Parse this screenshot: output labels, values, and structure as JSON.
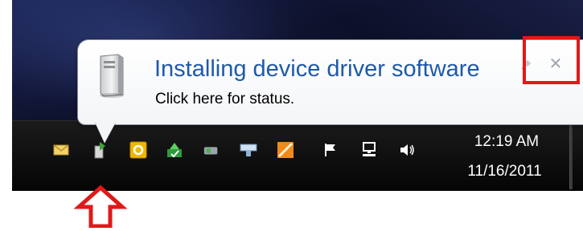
{
  "notification": {
    "title": "Installing device driver software",
    "body": "Click here for status."
  },
  "clock": {
    "time": "12:19 AM",
    "date": "11/16/2011"
  },
  "tray_icons": [
    "mail-icon",
    "device-driver-icon",
    "outlook-icon",
    "sync-icon",
    "vpn-icon",
    "keyboard-icon",
    "orange-app-icon",
    "action-center-flag-icon",
    "network-icon",
    "volume-icon"
  ],
  "colors": {
    "title_blue": "#1e5aa8",
    "highlight_red": "#e01919"
  }
}
